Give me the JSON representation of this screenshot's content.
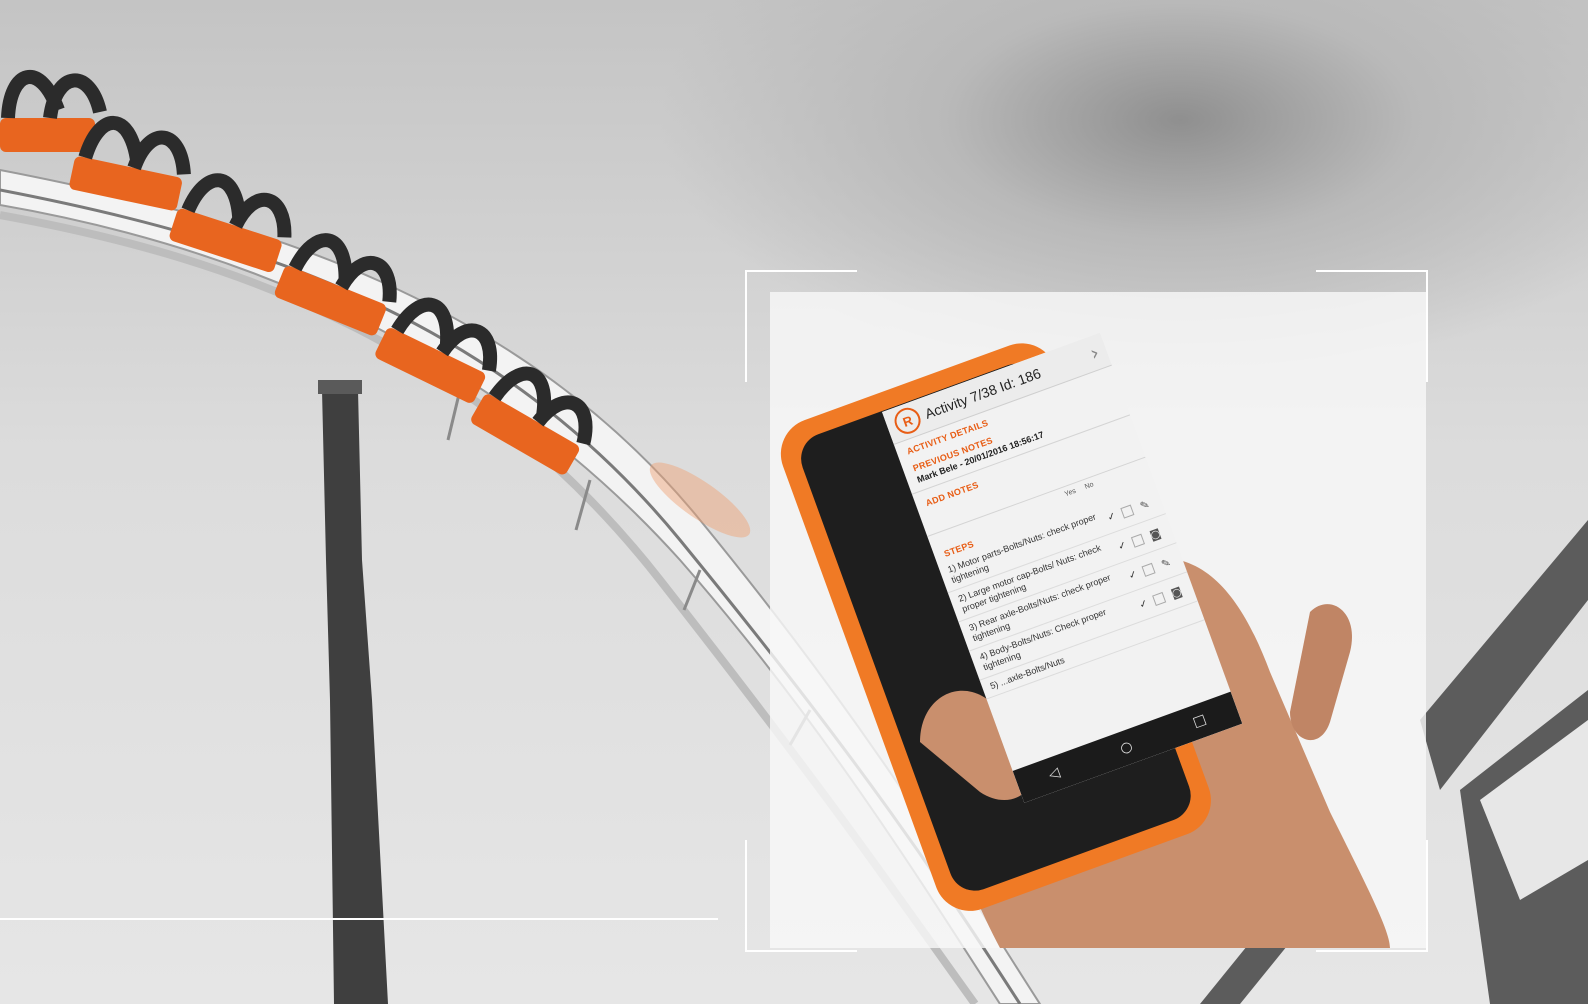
{
  "colors": {
    "accent": "#e85d15",
    "rail": "#f4f4f4",
    "pole": "#3a3a3a",
    "frame": "#ffffff"
  },
  "screen": {
    "title": "Activity 7/38 Id: 186",
    "logo_letter": "R",
    "sections": {
      "details": "ACTIVITY DETAILS",
      "previous_notes": "PREVIOUS NOTES",
      "add_notes": "ADD NOTES",
      "steps": "STEPS"
    },
    "previous_note": "Mark Bele - 20/01/2016 18:56:17",
    "step_columns": [
      "Yes",
      "No"
    ],
    "steps": [
      {
        "text": "1) Motor parts-Bolts/Nuts: check proper tightening"
      },
      {
        "text": "2) Large motor cap-Bolts/ Nuts: check proper tightening"
      },
      {
        "text": "3) Rear axle-Bolts/Nuts: check proper tightening"
      },
      {
        "text": "4) Body-Bolts/Nuts: Check proper tightening"
      },
      {
        "text": "5) ...axle-Bolts/Nuts"
      }
    ],
    "icons": {
      "tick": "check-icon",
      "edit": "pencil-icon",
      "camera": "camera-icon",
      "back": "back-triangle-icon",
      "home": "home-circle-icon",
      "recent": "recent-square-icon",
      "next": "chevron-right-icon"
    }
  }
}
